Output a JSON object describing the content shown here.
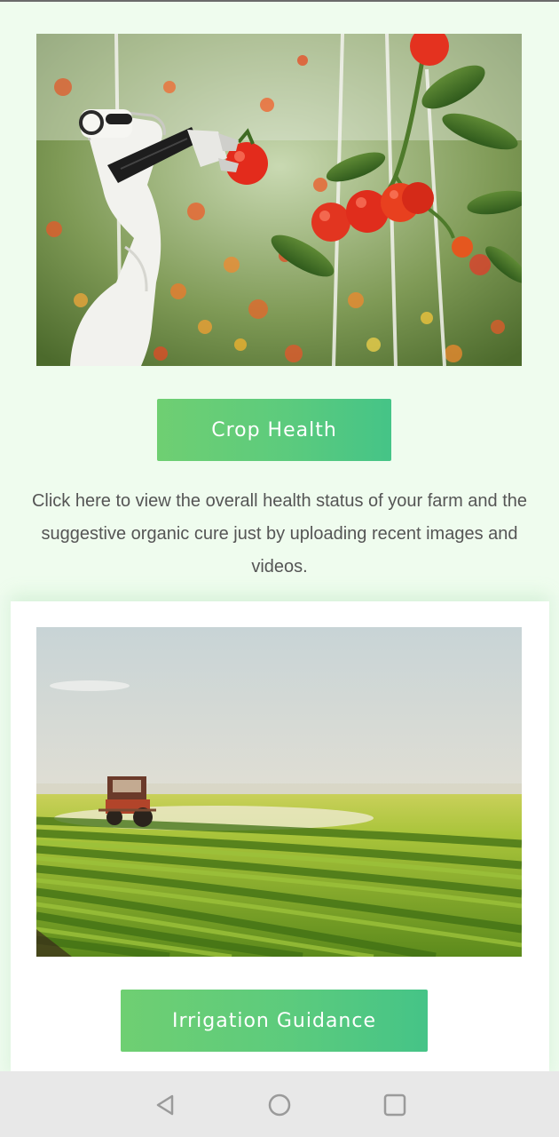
{
  "crop_health": {
    "image_alt": "Robotic arm picking tomatoes in greenhouse",
    "button_label": "Crop Health",
    "description": "Click here to view the overall health status of your farm and the suggestive organic cure just by uploading recent images and videos."
  },
  "irrigation": {
    "image_alt": "Tractor spraying a green crop field",
    "button_label": "Irrigation Guidance"
  },
  "navbar": {
    "icons": [
      "back-icon",
      "home-icon",
      "recent-apps-icon"
    ]
  },
  "colors": {
    "page_background": "#eefbee",
    "button_gradient_start": "#6fcf72",
    "button_gradient_end": "#45c487",
    "description_text": "#555555",
    "nav_background": "#e8e8e8"
  }
}
